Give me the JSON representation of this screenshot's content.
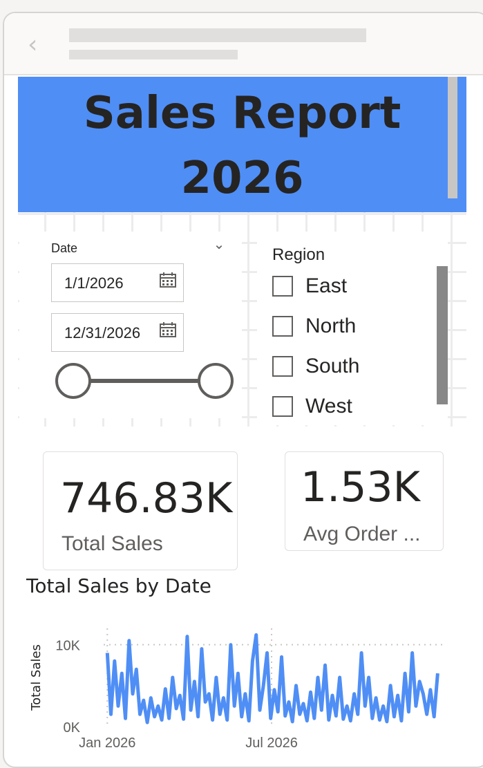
{
  "header": {
    "back_icon": "chevron-left-icon"
  },
  "banner": {
    "title": "Sales Report 2026",
    "background": "#4f8ef5"
  },
  "date_slicer": {
    "title": "Date",
    "start_date": "1/1/2026",
    "end_date": "12/31/2026",
    "start_fraction": 0,
    "end_fraction": 1
  },
  "region_slicer": {
    "title": "Region",
    "items": [
      {
        "label": "East",
        "checked": false
      },
      {
        "label": "North",
        "checked": false
      },
      {
        "label": "South",
        "checked": false
      },
      {
        "label": "West",
        "checked": false
      }
    ]
  },
  "cards": [
    {
      "value": "746.83K",
      "label": "Total Sales"
    },
    {
      "value": "1.53K",
      "label": "Avg Order ..."
    }
  ],
  "chart_data": {
    "type": "line",
    "title": "Total Sales by Date",
    "ylabel": "Total Sales",
    "xlabel": "",
    "ylim": [
      0,
      12000
    ],
    "yticks": [
      {
        "value": 0,
        "label": "0K"
      },
      {
        "value": 10000,
        "label": "10K"
      }
    ],
    "xticks": [
      {
        "value": "2026-01-01",
        "label": "Jan 2026"
      },
      {
        "value": "2026-07-01",
        "label": "Jul 2026"
      }
    ],
    "xlim": [
      "2025-12-28",
      "2027-01-05"
    ],
    "grid": true,
    "line_color": "#4f8ef5",
    "series": [
      {
        "x": [
          "2026-01-01",
          "2026-01-05",
          "2026-01-09",
          "2026-01-13",
          "2026-01-17",
          "2026-01-21",
          "2026-01-25",
          "2026-01-29",
          "2026-02-02",
          "2026-02-06",
          "2026-02-10",
          "2026-02-14",
          "2026-02-18",
          "2026-02-22",
          "2026-02-26",
          "2026-03-02",
          "2026-03-06",
          "2026-03-10",
          "2026-03-14",
          "2026-03-18",
          "2026-03-22",
          "2026-03-26",
          "2026-03-30",
          "2026-04-03",
          "2026-04-07",
          "2026-04-11",
          "2026-04-15",
          "2026-04-19",
          "2026-04-23",
          "2026-04-27",
          "2026-05-01",
          "2026-05-05",
          "2026-05-09",
          "2026-05-13",
          "2026-05-17",
          "2026-05-21",
          "2026-05-25",
          "2026-05-29",
          "2026-06-02",
          "2026-06-06",
          "2026-06-10",
          "2026-06-14",
          "2026-06-18",
          "2026-06-22",
          "2026-06-26",
          "2026-06-30",
          "2026-07-04",
          "2026-07-08",
          "2026-07-12",
          "2026-07-16",
          "2026-07-20",
          "2026-07-24",
          "2026-07-28",
          "2026-08-01",
          "2026-08-05",
          "2026-08-09",
          "2026-08-13",
          "2026-08-17",
          "2026-08-21",
          "2026-08-25",
          "2026-08-29",
          "2026-09-02",
          "2026-09-06",
          "2026-09-10",
          "2026-09-14",
          "2026-09-18",
          "2026-09-22",
          "2026-09-26",
          "2026-09-30",
          "2026-10-04",
          "2026-10-08",
          "2026-10-12",
          "2026-10-16",
          "2026-10-20",
          "2026-10-24",
          "2026-10-28",
          "2026-11-01",
          "2026-11-05",
          "2026-11-09",
          "2026-11-13",
          "2026-11-17",
          "2026-11-21",
          "2026-11-25",
          "2026-11-29",
          "2026-12-03",
          "2026-12-07",
          "2026-12-11",
          "2026-12-15",
          "2026-12-19",
          "2026-12-23",
          "2026-12-27",
          "2026-12-31"
        ],
        "values": [
          9000,
          1500,
          8000,
          2500,
          6500,
          1000,
          10500,
          4000,
          7000,
          1500,
          3200,
          500,
          3500,
          1200,
          2500,
          800,
          4600,
          1000,
          6000,
          2200,
          3800,
          900,
          11000,
          2000,
          5500,
          1200,
          9500,
          3000,
          4000,
          800,
          6000,
          1500,
          3500,
          800,
          10000,
          2500,
          6500,
          1200,
          4000,
          700,
          8000,
          11200,
          2000,
          5000,
          9000,
          1000,
          4500,
          1800,
          8500,
          1300,
          3000,
          600,
          5000,
          1500,
          2800,
          700,
          4200,
          1000,
          6000,
          2000,
          7500,
          800,
          3800,
          1300,
          6000,
          900,
          2500,
          700,
          4000,
          1500,
          9000,
          2500,
          6000,
          1000,
          3500,
          800,
          2500,
          600,
          5000,
          1200,
          3800,
          700,
          6500,
          1800,
          9000,
          2500,
          5500,
          4000,
          1500,
          4500,
          1200,
          6500
        ]
      }
    ]
  }
}
